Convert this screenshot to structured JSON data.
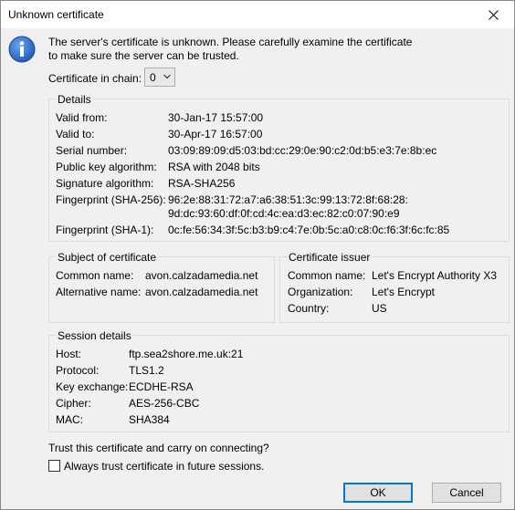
{
  "window": {
    "title": "Unknown certificate"
  },
  "message": {
    "line1": "The server's certificate is unknown. Please carefully examine the certificate",
    "line2": "to make sure the server can be trusted."
  },
  "chain": {
    "label": "Certificate in chain:",
    "selected": "0"
  },
  "details": {
    "title": "Details",
    "valid_from_label": "Valid from:",
    "valid_from": "30-Jan-17 15:57:00",
    "valid_to_label": "Valid to:",
    "valid_to": "30-Apr-17 16:57:00",
    "serial_label": "Serial number:",
    "serial": "03:09:89:09:d5:03:bd:cc:29:0e:90:c2:0d:b5:e3:7e:8b:ec",
    "pubkey_label": "Public key algorithm:",
    "pubkey": "RSA with 2048 bits",
    "sigalg_label": "Signature algorithm:",
    "sigalg": "RSA-SHA256",
    "fp256_label": "Fingerprint (SHA-256):",
    "fp256_line1": "96:2e:88:31:72:a7:a6:38:51:3c:99:13:72:8f:68:28:",
    "fp256_line2": "9d:dc:93:60:df:0f:cd:4c:ea:d3:ec:82:c0:07:90:e9",
    "fp1_label": "Fingerprint (SHA-1):",
    "fp1": "0c:fe:56:34:3f:5c:b3:b9:c4:7e:0b:5c:a0:c8:0c:f6:3f:6c:fc:85"
  },
  "subject": {
    "title": "Subject of certificate",
    "cn_label": "Common name:",
    "cn": "avon.calzadamedia.net",
    "alt_label": "Alternative name:",
    "alt": "avon.calzadamedia.net"
  },
  "issuer": {
    "title": "Certificate issuer",
    "cn_label": "Common name:",
    "cn": "Let's Encrypt Authority X3",
    "org_label": "Organization:",
    "org": "Let's Encrypt",
    "country_label": "Country:",
    "country": "US"
  },
  "session": {
    "title": "Session details",
    "host_label": "Host:",
    "host": "ftp.sea2shore.me.uk:21",
    "protocol_label": "Protocol:",
    "protocol": "TLS1.2",
    "kex_label": "Key exchange:",
    "kex": "ECDHE-RSA",
    "cipher_label": "Cipher:",
    "cipher": "AES-256-CBC",
    "mac_label": "MAC:",
    "mac": "SHA384"
  },
  "trust": {
    "question": "Trust this certificate and carry on connecting?",
    "always_label": "Always trust certificate in future sessions.",
    "always_checked": false
  },
  "buttons": {
    "ok": "OK",
    "cancel": "Cancel"
  },
  "colors": {
    "accent": "#0078d7",
    "dialog_bg": "#f0f0f0",
    "info_icon": "#2b6cc4"
  }
}
